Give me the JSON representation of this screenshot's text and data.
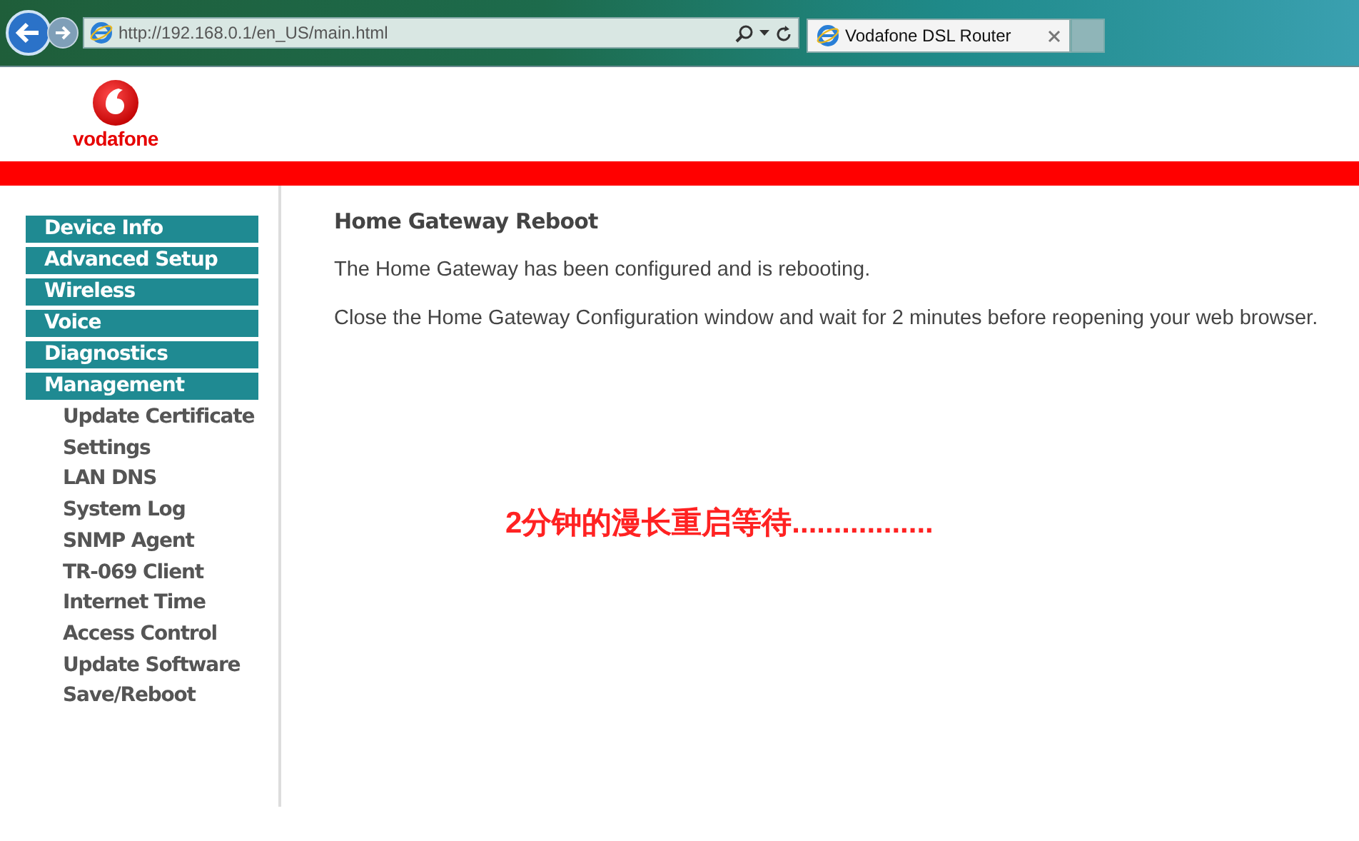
{
  "browser": {
    "address": "http://192.168.0.1/en_US/main.html",
    "tabs": [
      {
        "title": "Vodafone DSL Router",
        "selected": true
      }
    ]
  },
  "header": {
    "logo_text": "vodafone"
  },
  "sidebar": {
    "items": [
      {
        "label": "Device Info"
      },
      {
        "label": "Advanced Setup"
      },
      {
        "label": "Wireless"
      },
      {
        "label": "Voice"
      },
      {
        "label": "Diagnostics"
      },
      {
        "label": "Management",
        "children": [
          {
            "label": "Update Certificate"
          },
          {
            "label": "Settings"
          },
          {
            "label": "LAN DNS"
          },
          {
            "label": "System Log"
          },
          {
            "label": "SNMP Agent"
          },
          {
            "label": "TR-069 Client"
          },
          {
            "label": "Internet Time"
          },
          {
            "label": "Access Control"
          },
          {
            "label": "Update Software"
          },
          {
            "label": "Save/Reboot"
          }
        ]
      }
    ]
  },
  "content": {
    "title": "Home Gateway Reboot",
    "paragraphs": [
      "The Home Gateway has been configured and is rebooting.",
      "Close the Home Gateway Configuration window and wait for 2 minutes before reopening your web browser."
    ]
  },
  "annotation": "2分钟的漫长重启等待................."
}
